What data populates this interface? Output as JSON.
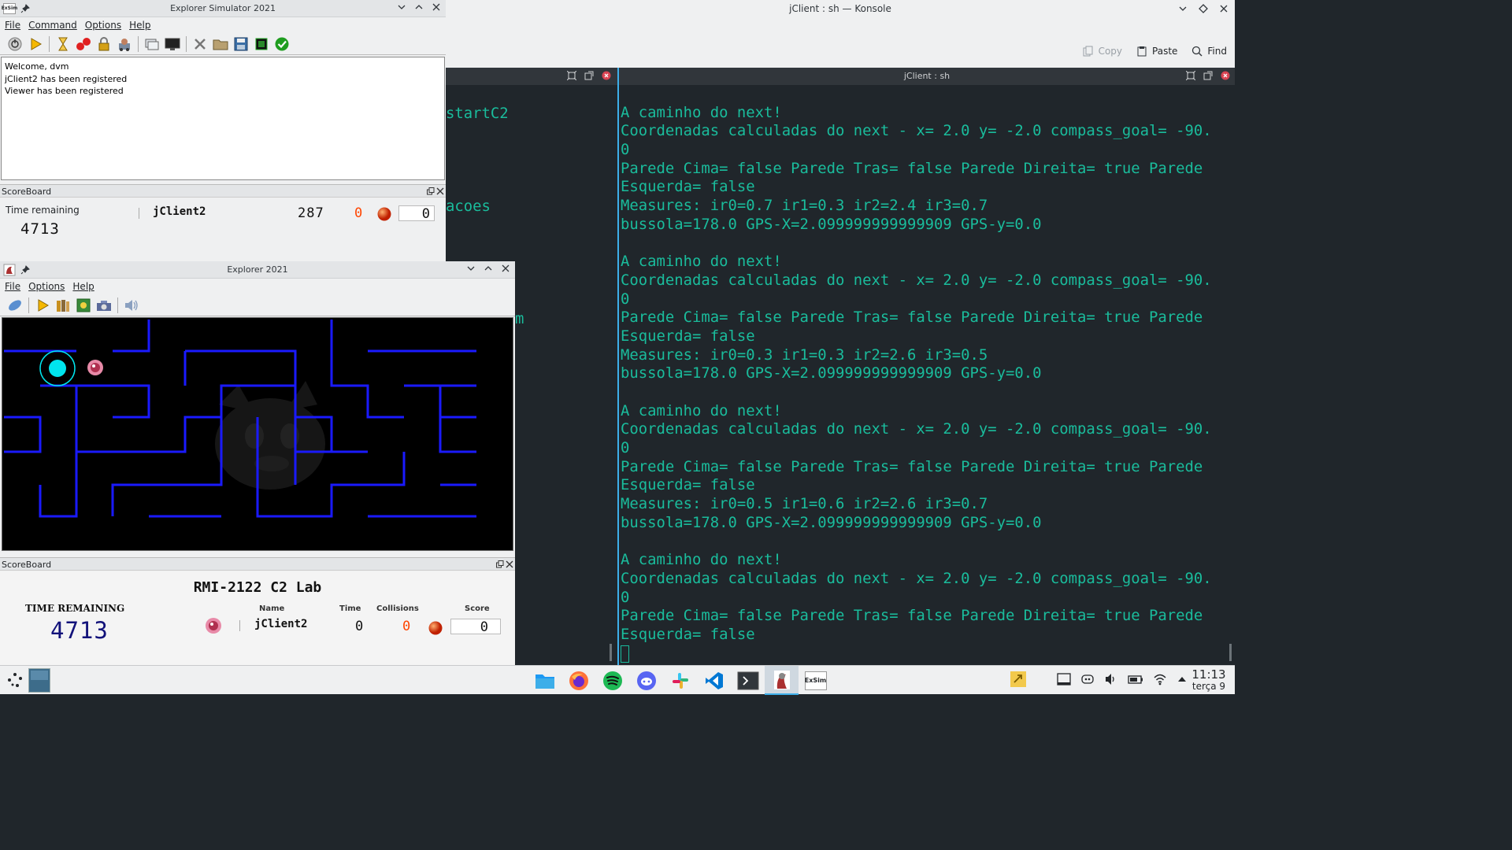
{
  "konsole": {
    "title": "jClient : sh — Konsole",
    "toolbar": {
      "copy": "Copy",
      "paste": "Paste",
      "find": "Find"
    },
    "left_pane_fragments": [
      "startC2",
      "acoes",
      "m"
    ],
    "right_pane": {
      "title": "jClient : sh",
      "lines": [
        "",
        "A caminho do next!",
        "Coordenadas calculadas do next - x= 2.0 y= -2.0 compass_goal= -90.",
        "0",
        "Parede Cima= false Parede Tras= false Parede Direita= true Parede",
        "Esquerda= false",
        "Measures: ir0=0.7 ir1=0.3 ir2=2.4 ir3=0.7",
        "bussola=178.0 GPS-X=2.099999999999909 GPS-y=0.0",
        "",
        "A caminho do next!",
        "Coordenadas calculadas do next - x= 2.0 y= -2.0 compass_goal= -90.",
        "0",
        "Parede Cima= false Parede Tras= false Parede Direita= true Parede",
        "Esquerda= false",
        "Measures: ir0=0.3 ir1=0.3 ir2=2.6 ir3=0.5",
        "bussola=178.0 GPS-X=2.099999999999909 GPS-y=0.0",
        "",
        "A caminho do next!",
        "Coordenadas calculadas do next - x= 2.0 y= -2.0 compass_goal= -90.",
        "0",
        "Parede Cima= false Parede Tras= false Parede Direita= true Parede",
        "Esquerda= false",
        "Measures: ir0=0.5 ir1=0.6 ir2=2.6 ir3=0.7",
        "bussola=178.0 GPS-X=2.099999999999909 GPS-y=0.0",
        "",
        "A caminho do next!",
        "Coordenadas calculadas do next - x= 2.0 y= -2.0 compass_goal= -90.",
        "0",
        "Parede Cima= false Parede Tras= false Parede Direita= true Parede",
        "Esquerda= false"
      ]
    }
  },
  "simulator": {
    "title": "Explorer Simulator 2021",
    "icon_text": "ExSim",
    "menu": [
      "File",
      "Command",
      "Options",
      "Help"
    ],
    "messages": [
      "Welcome, dvm",
      "jClient2 has been registered",
      "Viewer has been registered"
    ],
    "scoreboard": {
      "title": "ScoreBoard",
      "time_label": "Time remaining",
      "time_value": "4713",
      "robot_name": "jClient2",
      "robot_time": "287",
      "collisions": "0",
      "score": "0"
    }
  },
  "viewer": {
    "title": "Explorer 2021",
    "menu": [
      "File",
      "Options",
      "Help"
    ],
    "scoreboard": {
      "title": "ScoreBoard",
      "lab_title": "RMI-2122 C2 Lab",
      "time_label": "TIME REMAINING",
      "time_value": "4713",
      "headers": {
        "name": "Name",
        "time": "Time",
        "collisions": "Collisions",
        "score": "Score"
      },
      "robot": {
        "name": "jClient2",
        "time": "0",
        "collisions": "0",
        "score": "0"
      }
    }
  },
  "taskbar": {
    "clock_time": "11:13",
    "clock_date": "terça 9",
    "exsim_label": "ExSim"
  },
  "colors": {
    "maze_wall": "#1a1aff",
    "robot": "#00e5ee",
    "terminal_text": "#1abc9c",
    "terminal_bg": "#20262b",
    "lcd_red": "#ff4500"
  }
}
